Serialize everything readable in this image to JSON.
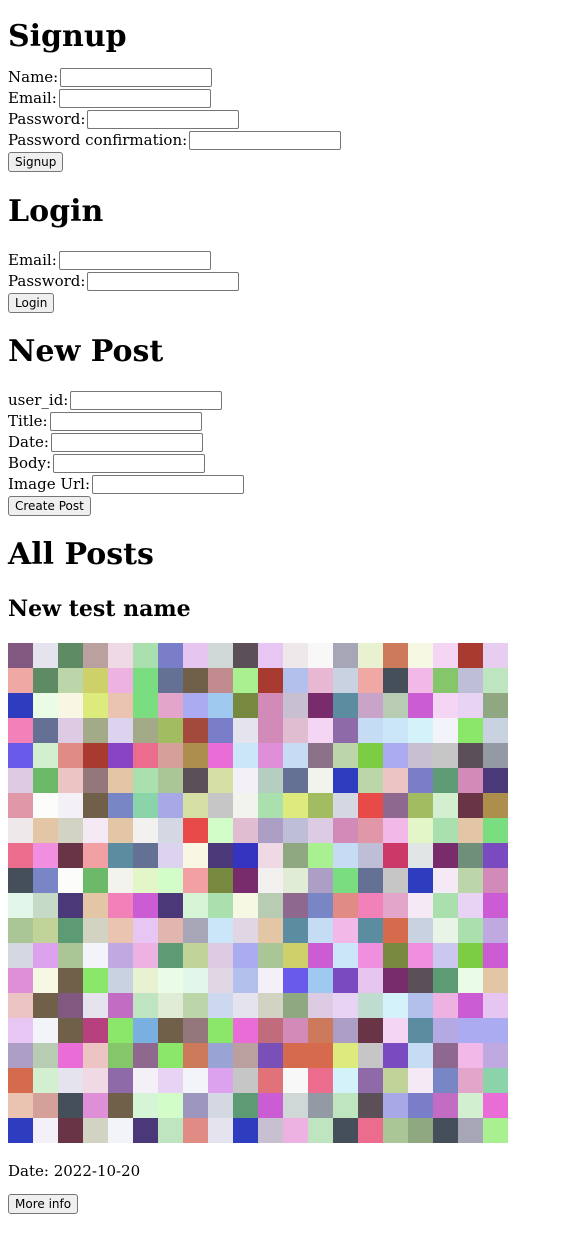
{
  "signup": {
    "heading": "Signup",
    "fields": [
      {
        "label": "Name:",
        "value": ""
      },
      {
        "label": "Email:",
        "value": ""
      },
      {
        "label": "Password:",
        "value": ""
      },
      {
        "label": "Password confirmation:",
        "value": ""
      }
    ],
    "button": "Signup"
  },
  "login": {
    "heading": "Login",
    "fields": [
      {
        "label": "Email:",
        "value": ""
      },
      {
        "label": "Password:",
        "value": ""
      }
    ],
    "button": "Login"
  },
  "new_post": {
    "heading": "New Post",
    "fields": [
      {
        "label": "user_id:",
        "value": ""
      },
      {
        "label": "Title:",
        "value": ""
      },
      {
        "label": "Date:",
        "value": ""
      },
      {
        "label": "Body:",
        "value": ""
      },
      {
        "label": "Image Url:",
        "value": ""
      }
    ],
    "button": "Create Post"
  },
  "all_posts": {
    "heading": "All Posts",
    "posts": [
      {
        "title": "New test name",
        "date_text": "Date: 2022-10-20",
        "more_button": "More info"
      }
    ]
  }
}
